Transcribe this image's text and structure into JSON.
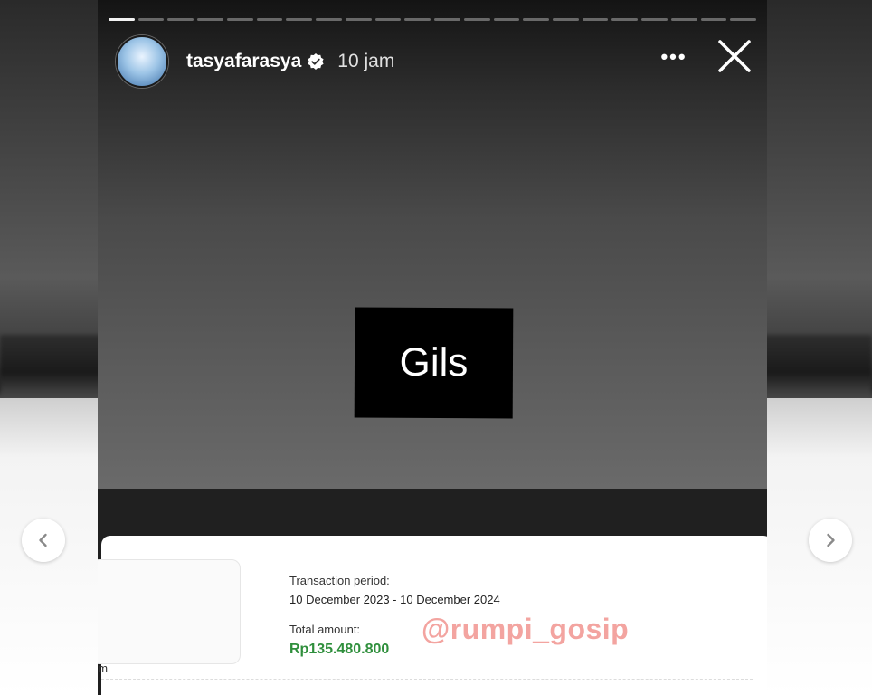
{
  "header": {
    "username": "tasyafarasya",
    "time": "10 jam"
  },
  "story": {
    "progress_total": 22,
    "progress_done": 1,
    "sticker_text": "Gils"
  },
  "card": {
    "fragment_text": "om",
    "transaction_period_label": "Transaction period:",
    "transaction_period_value": "10 December 2023 - 10 December 2024",
    "total_amount_label": "Total amount:",
    "total_amount_value": "Rp135.480.800",
    "watermark": "@rumpi_gosip"
  },
  "icons": {
    "verified": "verified-badge-icon",
    "more": "more-options-icon",
    "close": "close-icon",
    "prev": "chevron-left-icon",
    "next": "chevron-right-icon"
  },
  "colors": {
    "amount_green": "#2f8f3c",
    "watermark_pink": "#f3a4a0"
  }
}
